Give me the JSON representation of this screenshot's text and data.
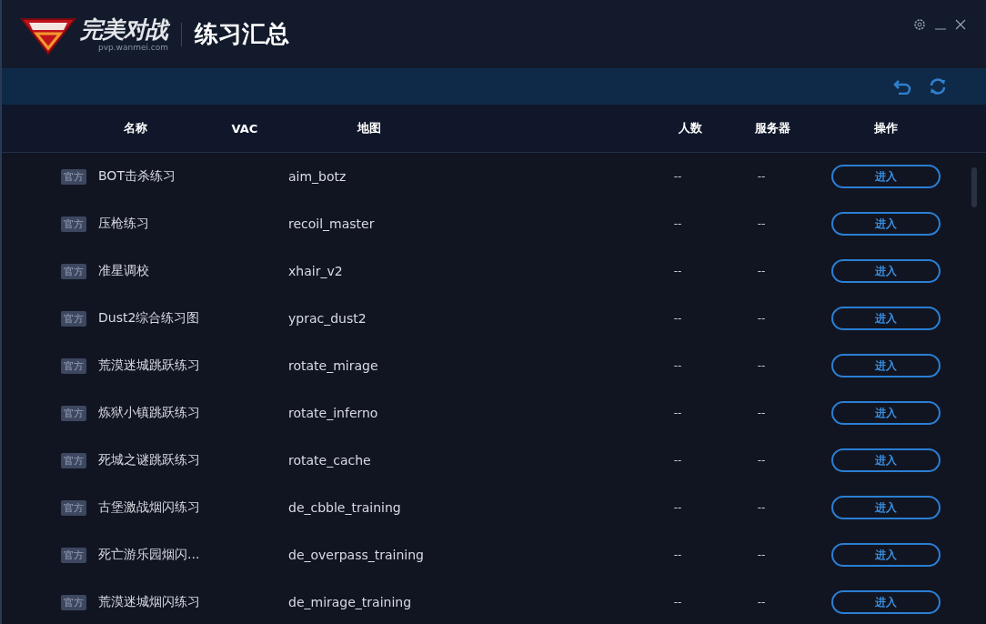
{
  "header": {
    "brand": "完美对战",
    "brand_url": "pvp.wanmei.com",
    "title": "练习汇总"
  },
  "table": {
    "columns": [
      "名称",
      "VAC",
      "地图",
      "人数",
      "服务器",
      "操作"
    ],
    "rows": [
      {
        "tag": "官方",
        "name": "BOT击杀练习",
        "map": "aim_botz",
        "players": "--",
        "server": "--",
        "action": "进入"
      },
      {
        "tag": "官方",
        "name": "压枪练习",
        "map": "recoil_master",
        "players": "--",
        "server": "--",
        "action": "进入"
      },
      {
        "tag": "官方",
        "name": "准星调校",
        "map": "xhair_v2",
        "players": "--",
        "server": "--",
        "action": "进入"
      },
      {
        "tag": "官方",
        "name": "Dust2综合练习图",
        "map": "yprac_dust2",
        "players": "--",
        "server": "--",
        "action": "进入"
      },
      {
        "tag": "官方",
        "name": "荒漠迷城跳跃练习",
        "map": "rotate_mirage",
        "players": "--",
        "server": "--",
        "action": "进入"
      },
      {
        "tag": "官方",
        "name": "炼狱小镇跳跃练习",
        "map": "rotate_inferno",
        "players": "--",
        "server": "--",
        "action": "进入"
      },
      {
        "tag": "官方",
        "name": "死城之谜跳跃练习",
        "map": "rotate_cache",
        "players": "--",
        "server": "--",
        "action": "进入"
      },
      {
        "tag": "官方",
        "name": "古堡激战烟闪练习",
        "map": "de_cbble_training",
        "players": "--",
        "server": "--",
        "action": "进入"
      },
      {
        "tag": "官方",
        "name": "死亡游乐园烟闪...",
        "map": "de_overpass_training",
        "players": "--",
        "server": "--",
        "action": "进入"
      },
      {
        "tag": "官方",
        "name": "荒漠迷城烟闪练习",
        "map": "de_mirage_training",
        "players": "--",
        "server": "--",
        "action": "进入"
      }
    ]
  }
}
